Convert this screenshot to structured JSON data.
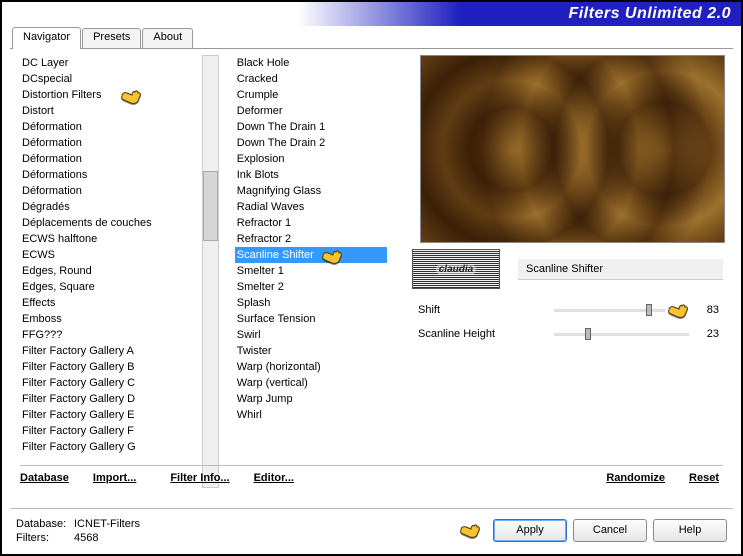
{
  "app_title": "Filters Unlimited 2.0",
  "tabs": {
    "t0": "Navigator",
    "t1": "Presets",
    "t2": "About"
  },
  "col1": [
    "DC Layer",
    "DCspecial",
    "Distortion Filters",
    "Distort",
    "Déformation",
    "Déformation",
    "Déformation",
    "Déformations",
    "Déformation",
    "Dégradés",
    "Déplacements de couches",
    "ECWS halftone",
    "ECWS",
    "Edges, Round",
    "Edges, Square",
    "Effects",
    "Emboss",
    "FFG???",
    "Filter Factory Gallery A",
    "Filter Factory Gallery B",
    "Filter Factory Gallery C",
    "Filter Factory Gallery D",
    "Filter Factory Gallery E",
    "Filter Factory Gallery F",
    "Filter Factory Gallery G"
  ],
  "col2": [
    "Black Hole",
    "Cracked",
    "Crumple",
    "Deformer",
    "Down The Drain 1",
    "Down The Drain 2",
    "Explosion",
    "Ink Blots",
    "Magnifying Glass",
    "Radial Waves",
    "Refractor 1",
    "Refractor 2",
    "Scanline Shifter",
    "Smelter 1",
    "Smelter 2",
    "Splash",
    "Surface Tension",
    "Swirl",
    "Twister",
    "Warp (horizontal)",
    "Warp (vertical)",
    "Warp Jump",
    "Whirl"
  ],
  "selected_col2_index": 12,
  "pointer_col1_index": 2,
  "param_title": "Scanline Shifter",
  "logo_text": "claudia",
  "params": [
    {
      "label": "Shift",
      "value": 83,
      "pct": 83
    },
    {
      "label": "Scanline Height",
      "value": 23,
      "pct": 23
    }
  ],
  "links": {
    "database": "Database",
    "import": "Import...",
    "filterinfo": "Filter Info...",
    "editor": "Editor...",
    "randomize": "Randomize",
    "reset": "Reset"
  },
  "footer": {
    "db_label": "Database:",
    "db_value": "ICNET-Filters",
    "filters_label": "Filters:",
    "filters_value": "4568",
    "apply": "Apply",
    "cancel": "Cancel",
    "help": "Help"
  }
}
